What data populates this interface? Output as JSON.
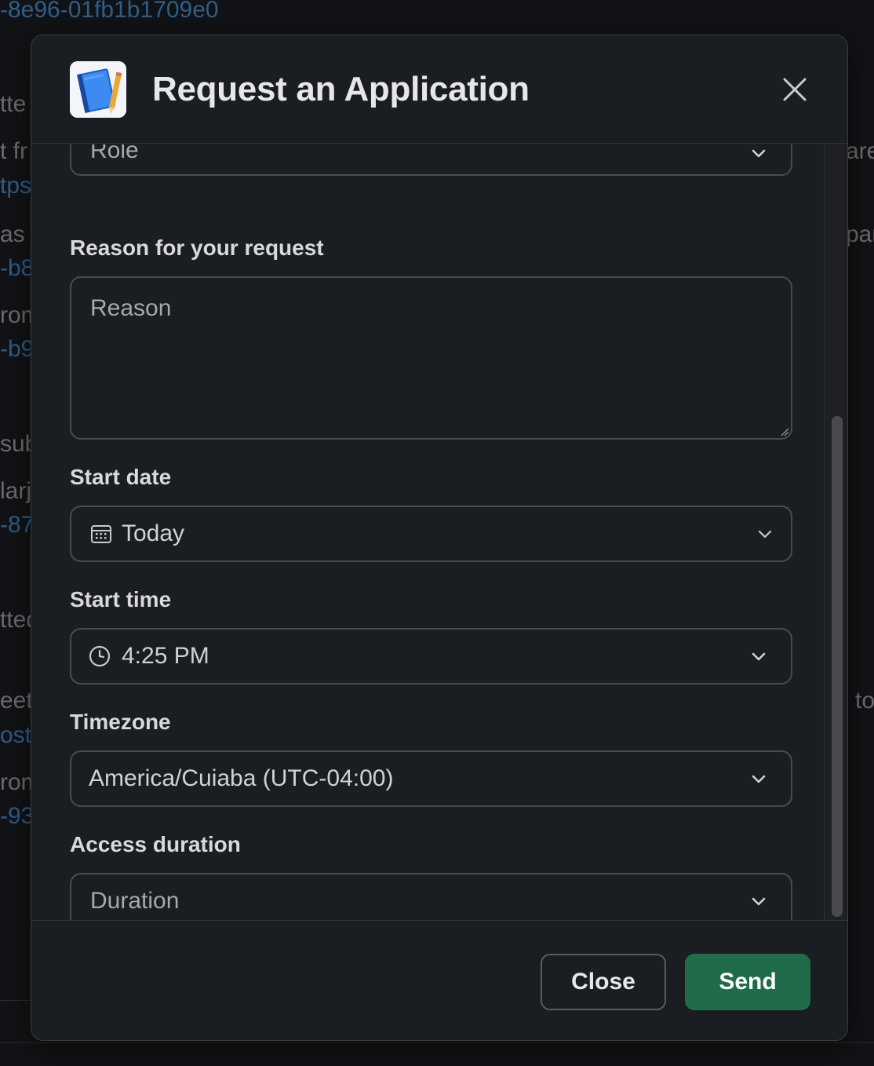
{
  "background": {
    "texts": [
      {
        "text": "-8e96-01fb1b1709e0",
        "link": true
      },
      {
        "text": "tte",
        "link": false
      },
      {
        "text": "t fr",
        "link": false
      },
      {
        "text": "tps",
        "link": true
      },
      {
        "text": "as r",
        "link": false
      },
      {
        "text": "-b8",
        "link": true
      },
      {
        "text": "rom",
        "link": false
      },
      {
        "text": "-b9",
        "link": true
      },
      {
        "text": "sub",
        "link": false
      },
      {
        "text": "larj",
        "link": false
      },
      {
        "text": "-87",
        "link": true
      },
      {
        "text": "tted",
        "link": false
      },
      {
        "text": "eet",
        "link": false
      },
      {
        "text": "ost:",
        "link": true
      },
      {
        "text": "rom",
        "link": false
      },
      {
        "text": "-93",
        "link": true
      },
      {
        "text": "are",
        "link": false
      },
      {
        "text": "par",
        "link": false
      },
      {
        "text": "to",
        "link": false
      }
    ]
  },
  "modal": {
    "title": "Request an Application",
    "app_icon": "notebook-icon",
    "close_icon": "close-icon"
  },
  "form": {
    "role": {
      "value": "Role",
      "icon": "chevron-down-icon"
    },
    "reason": {
      "label": "Reason for your request",
      "placeholder": "Reason"
    },
    "start_date": {
      "label": "Start date",
      "value": "Today",
      "icon": "calendar-icon"
    },
    "start_time": {
      "label": "Start time",
      "value": "4:25 PM",
      "icon": "clock-icon"
    },
    "timezone": {
      "label": "Timezone",
      "value": "America/Cuiaba (UTC-04:00)"
    },
    "duration": {
      "label": "Access duration",
      "placeholder": "Duration"
    }
  },
  "footer": {
    "close_label": "Close",
    "send_label": "Send"
  },
  "colors": {
    "send_button": "#1f6b4a",
    "modal_bg": "#1a1d21",
    "border": "#4a4b50"
  }
}
